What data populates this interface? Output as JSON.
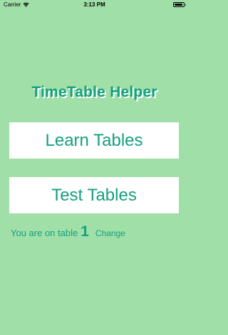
{
  "status_bar": {
    "carrier": "Carrier",
    "time": "3:13 PM",
    "wifi_icon": "wifi-icon",
    "battery_icon": "battery-icon"
  },
  "app": {
    "title": "TimeTable Helper",
    "learn_button": "Learn Tables",
    "test_button": "Test Tables",
    "table_label": "You are on table",
    "table_number": "1",
    "change_link": "Change"
  },
  "colors": {
    "background": "#a0dfa8",
    "accent": "#15a07e",
    "button_bg": "#ffffff"
  }
}
